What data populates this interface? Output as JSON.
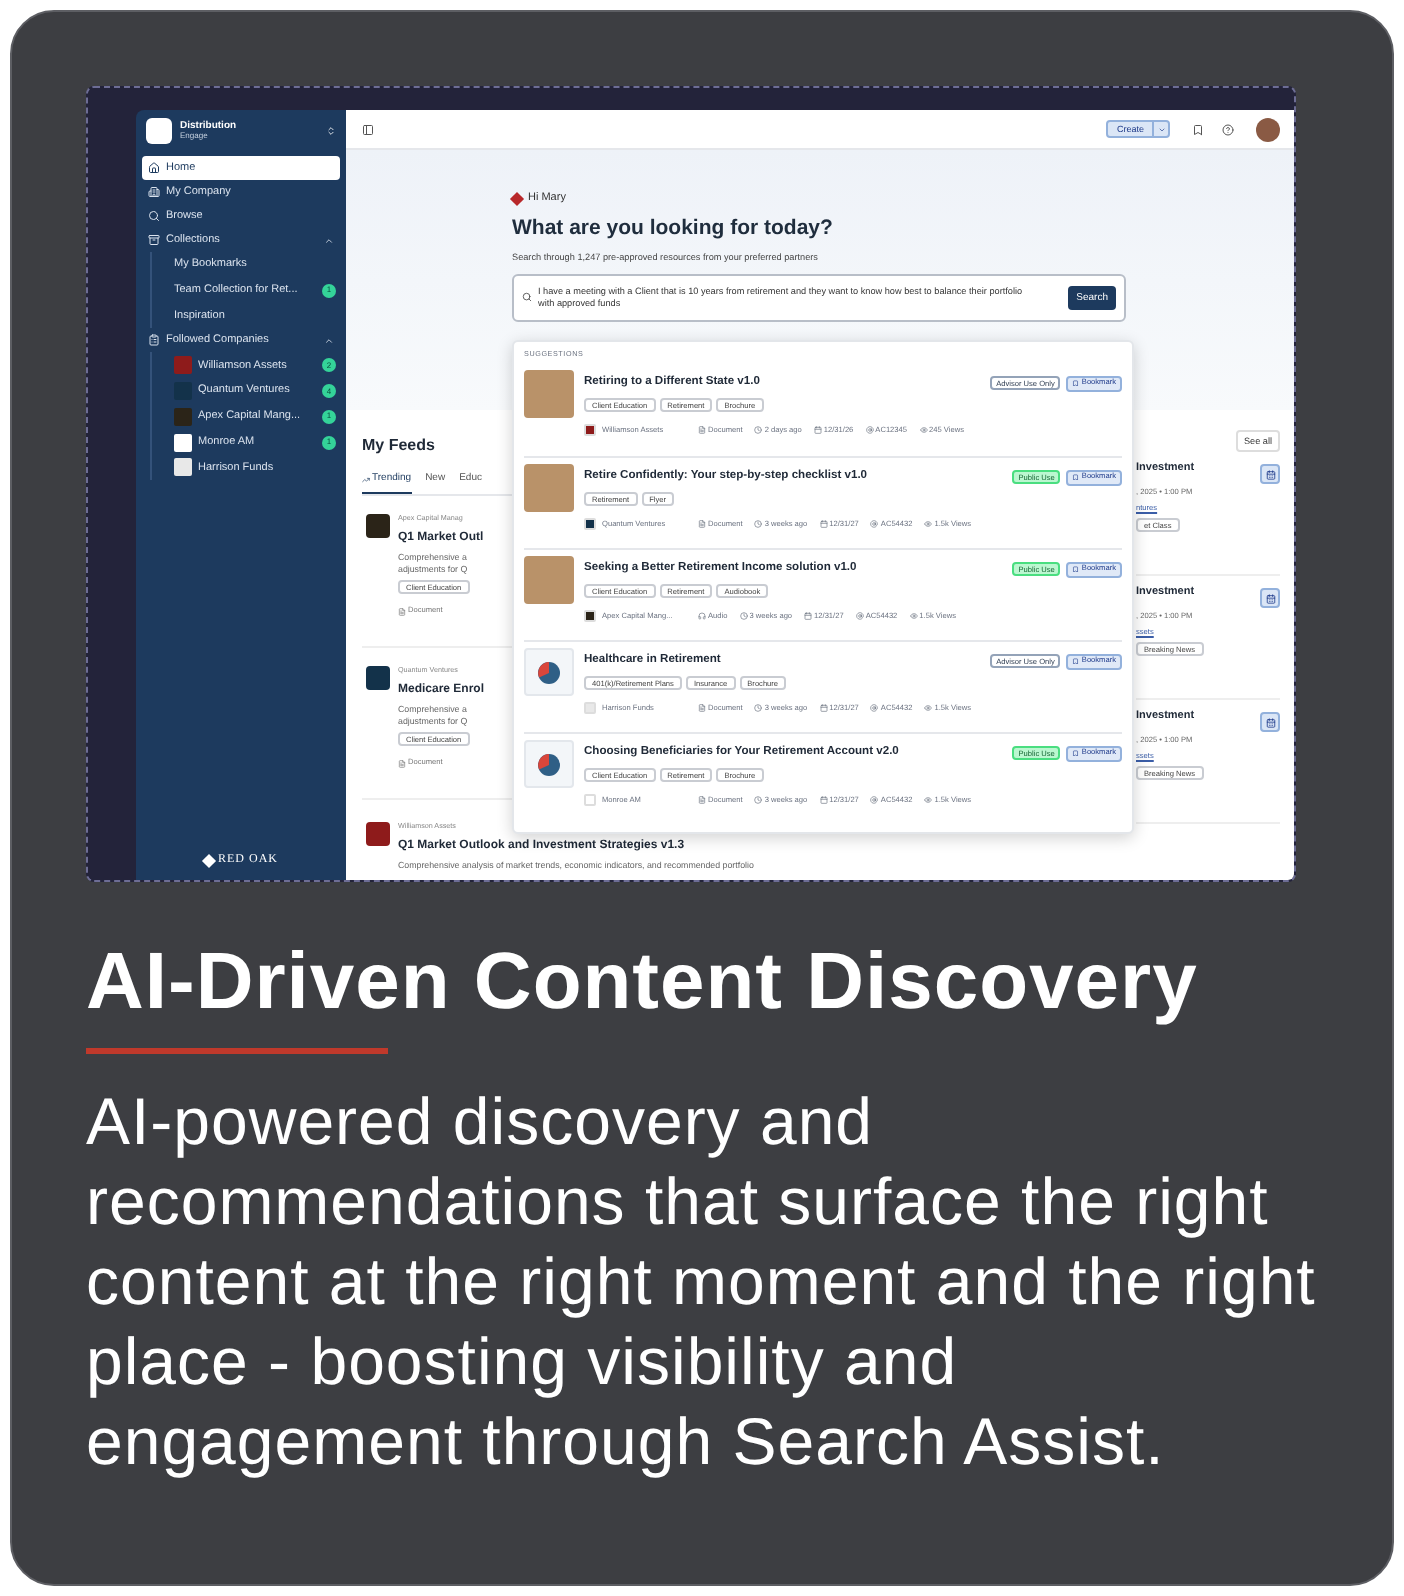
{
  "screenshot": {
    "sidebar": {
      "brand_name": "Distribution",
      "brand_sub": "Engage",
      "items": [
        {
          "label": "Home",
          "selected": true
        },
        {
          "label": "My Company",
          "selected": false
        },
        {
          "label": "Browse",
          "selected": false
        },
        {
          "label": "Collections",
          "selected": false,
          "expanded": true,
          "children": [
            {
              "label": "My Bookmarks",
              "selected": false
            },
            {
              "label": "Team Collection for Ret...",
              "badge": "1",
              "selected": false
            },
            {
              "label": "Inspiration",
              "selected": false
            }
          ]
        },
        {
          "label": "Followed Companies",
          "selected": false,
          "expanded": true,
          "children": [
            {
              "label": "Williamson Assets",
              "color": "#8e1b1b",
              "badge": "2",
              "selected": false
            },
            {
              "label": "Quantum Ventures",
              "color": "#13324a",
              "badge": "4",
              "selected": false
            },
            {
              "label": "Apex Capital Mang...",
              "color": "#2b2418",
              "badge": "1",
              "selected": false
            },
            {
              "label": "Monroe AM",
              "color": "#ffffff",
              "badge": "1",
              "selected": false
            },
            {
              "label": "Harrison Funds",
              "color": "#e8e8e8",
              "selected": false
            }
          ]
        }
      ],
      "footer_logo": "RED OAK"
    },
    "top_bar": {
      "create_button": "Create"
    },
    "hero": {
      "greeting": "Hi Mary",
      "heading": "What are you looking for today?",
      "subtitle": "Search through 1,247 pre-approved resources from your preferred partners",
      "search_value": "I have a meeting with a Client that is 10 years from retirement and they want to know how best to balance their portfolio with approved funds",
      "search_button": "Search"
    },
    "feeds": {
      "heading": "My Feeds",
      "see_all": "See all",
      "tabs": [
        {
          "label": "Trending",
          "selected": true
        },
        {
          "label": "New",
          "selected": false
        },
        {
          "label": "Educ",
          "selected": false
        }
      ],
      "posts": [
        {
          "company": "Apex Capital Manag",
          "color": "#2b2418",
          "title": "Q1 Market Outl",
          "description": "Comprehensive a adjustments for Q",
          "tag": "Client Education",
          "type": "Document"
        },
        {
          "company": "Quantum Ventures",
          "color": "#13324a",
          "title": "Medicare Enrol",
          "description": "Comprehensive a adjustments for Q",
          "tag": "Client Education",
          "type": "Document"
        },
        {
          "company": "Williamson Assets",
          "color": "#8e1b1b",
          "title": "Q1 Market Outlook and Investment Strategies v1.3",
          "description": "Comprehensive analysis of market trends, economic indicators, and recommended portfolio"
        }
      ],
      "events": [
        {
          "title": "Investment",
          "date": ", 2025 • 1:00 PM",
          "link": "ntures",
          "tag": "et Class"
        },
        {
          "title": "Investment",
          "date": ", 2025 • 1:00 PM",
          "link": "ssets",
          "tag": "Breaking News"
        },
        {
          "title": "Investment",
          "date": ", 2025 • 1:00 PM",
          "link": "ssets",
          "tag": "Breaking News"
        }
      ]
    },
    "suggestions": {
      "label": "SUGGESTIONS",
      "items": [
        {
          "kind": "photo",
          "title": "Retiring to a Different State v1.0",
          "tags": [
            "Client Education",
            "Retirement",
            "Brochure"
          ],
          "access": {
            "label": "Advisor Use Only",
            "kind": "advisor"
          },
          "bookmark": "Bookmark",
          "company": "Williamson Assets",
          "color": "#8e1b1b",
          "type": {
            "label": "Document",
            "kind": "document"
          },
          "time": "2 days ago",
          "date": "12/31/26",
          "code": "AC12345",
          "views": "245 Views"
        },
        {
          "kind": "photo",
          "title": "Retire Confidently: Your step-by-step checklist v1.0",
          "tags": [
            "Retirement",
            "Flyer"
          ],
          "access": {
            "label": "Public Use",
            "kind": "public"
          },
          "bookmark": "Bookmark",
          "company": "Quantum Ventures",
          "color": "#13324a",
          "type": {
            "label": "Document",
            "kind": "document"
          },
          "time": "3 weeks ago",
          "date": "12/31/27",
          "code": "AC54432",
          "views": "1.5k Views"
        },
        {
          "kind": "photo",
          "title": "Seeking a Better Retirement Income solution v1.0",
          "tags": [
            "Client Education",
            "Retirement",
            "Audiobook"
          ],
          "access": {
            "label": "Public Use",
            "kind": "public"
          },
          "bookmark": "Bookmark",
          "company": "Apex Capital Mang...",
          "color": "#2b2418",
          "type": {
            "label": "Audio",
            "kind": "audio"
          },
          "time": "3 weeks ago",
          "date": "12/31/27",
          "code": "AC54432",
          "views": "1.5k Views"
        },
        {
          "kind": "chart",
          "title": "Healthcare in Retirement",
          "tags": [
            "401(k)/Retirement Plans",
            "Insurance",
            "Brochure"
          ],
          "access": {
            "label": "Advisor Use Only",
            "kind": "advisor"
          },
          "bookmark": "Bookmark",
          "company": "Harrison Funds",
          "color": "#e8e8e8",
          "type": {
            "label": "Document",
            "kind": "document"
          },
          "time": "3 weeks ago",
          "date": "12/31/27",
          "code": "AC54432",
          "views": "1.5k Views"
        },
        {
          "kind": "chart",
          "title": "Choosing Beneficiaries for Your Retirement Account v2.0",
          "tags": [
            "Client Education",
            "Retirement",
            "Brochure"
          ],
          "access": {
            "label": "Public Use",
            "kind": "public"
          },
          "bookmark": "Bookmark",
          "company": "Monroe AM",
          "color": "#ffffff",
          "type": {
            "label": "Document",
            "kind": "document"
          },
          "time": "3 weeks ago",
          "date": "12/31/27",
          "code": "AC54432",
          "views": "1.5k Views"
        }
      ]
    }
  },
  "title": "AI-Driven Content Discovery",
  "description": "AI-powered discovery and recommendations that surface the right content at the right moment and the right place - boosting visibility and engagement through Search Assist."
}
